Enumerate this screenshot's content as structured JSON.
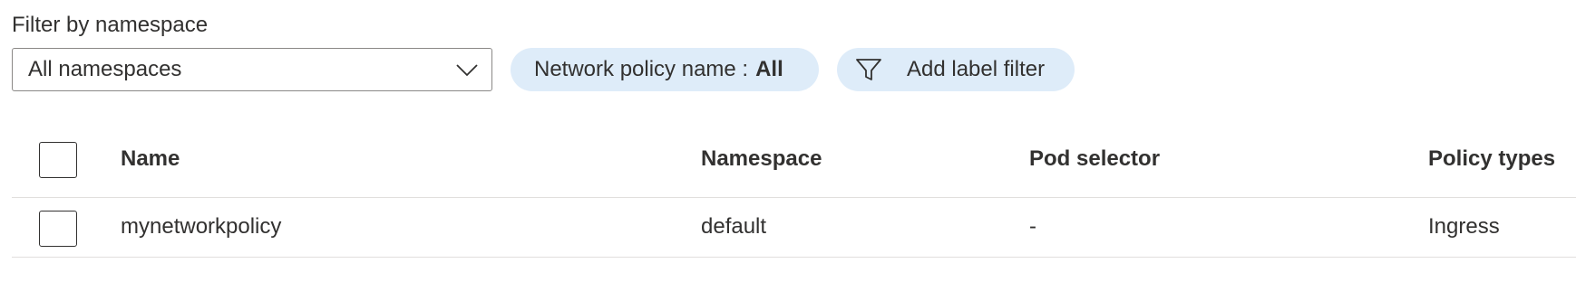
{
  "filter": {
    "label": "Filter by namespace",
    "namespace_selected": "All namespaces"
  },
  "pills": {
    "policy_name_label": "Network policy name :",
    "policy_name_value": "All",
    "add_label_filter": "Add label filter"
  },
  "table": {
    "columns": [
      "Name",
      "Namespace",
      "Pod selector",
      "Policy types"
    ],
    "rows": [
      {
        "name": "mynetworkpolicy",
        "namespace": "default",
        "pod_selector": "-",
        "policy_types": "Ingress"
      }
    ]
  },
  "colors": {
    "pill_background": "#deecf9",
    "link": "#0f6cbd",
    "border": "#8a8886",
    "divider": "#e1dfdd"
  },
  "icons": {
    "dropdown": "chevron-down-icon",
    "filter": "filter-icon"
  }
}
